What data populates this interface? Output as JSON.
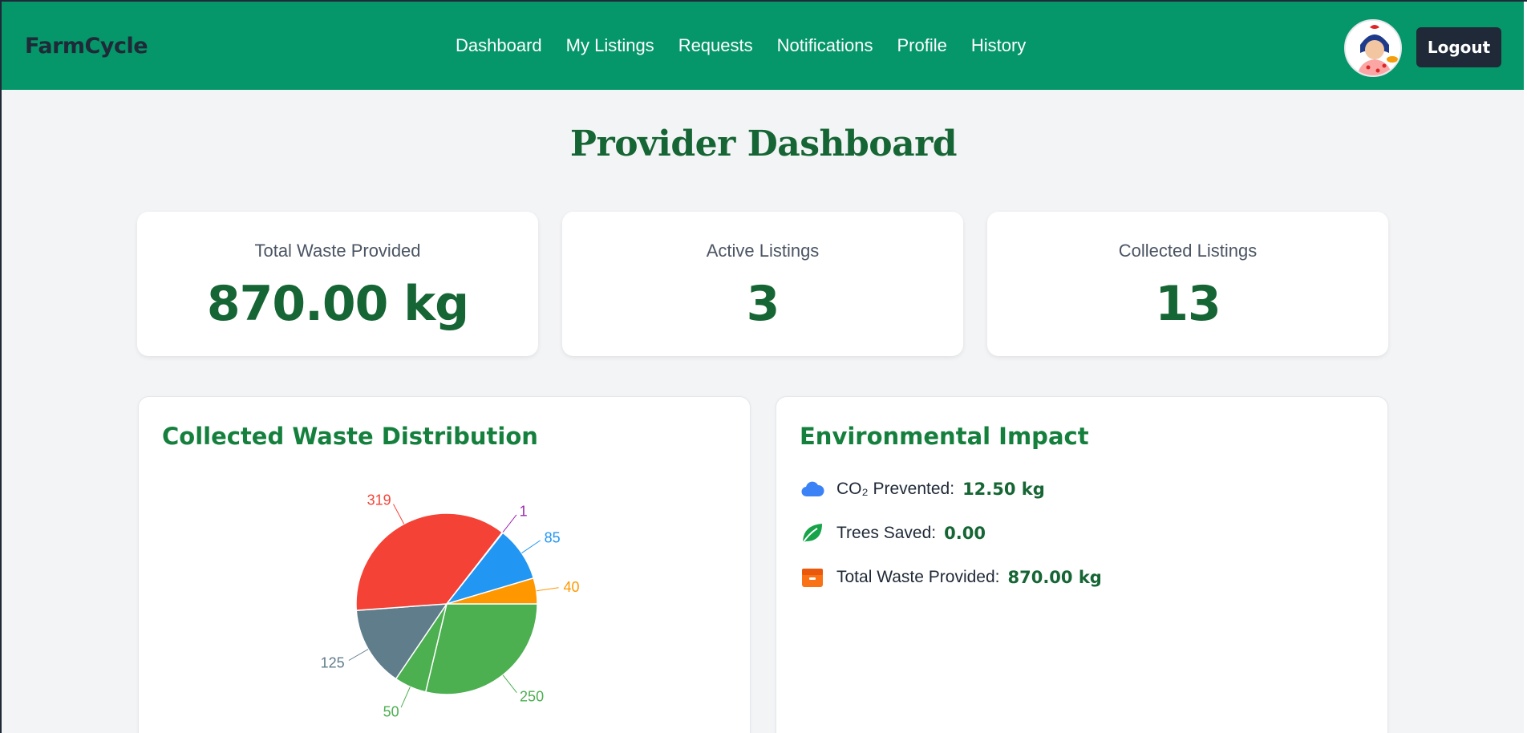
{
  "navbar": {
    "brand": "FarmCycle",
    "links": [
      "Dashboard",
      "My Listings",
      "Requests",
      "Notifications",
      "Profile",
      "History"
    ],
    "logout_label": "Logout",
    "bg_color": "#059669"
  },
  "page_title": "Provider Dashboard",
  "stats": [
    {
      "label": "Total Waste Provided",
      "value": "870.00 kg"
    },
    {
      "label": "Active Listings",
      "value": "3"
    },
    {
      "label": "Collected Listings",
      "value": "13"
    }
  ],
  "distribution_panel": {
    "title": "Collected Waste Distribution"
  },
  "impact_panel": {
    "title": "Environmental Impact",
    "rows": [
      {
        "icon": "cloud-icon",
        "label": "CO₂ Prevented:",
        "value": "12.50 kg"
      },
      {
        "icon": "leaf-icon",
        "label": "Trees Saved:",
        "value": "0.00"
      },
      {
        "icon": "box-icon",
        "label": "Total Waste Provided:",
        "value": "870.00 kg"
      }
    ]
  },
  "chart_data": {
    "type": "pie",
    "values": [
      250,
      50,
      125,
      319,
      1,
      85,
      40
    ],
    "colors": [
      "#4caf50",
      "#4caf50",
      "#607d8b",
      "#f44336",
      "#9c27b0",
      "#2196f3",
      "#ff9800"
    ],
    "labels": [
      "250",
      "50",
      "125",
      "319",
      "1",
      "85",
      "40"
    ]
  }
}
